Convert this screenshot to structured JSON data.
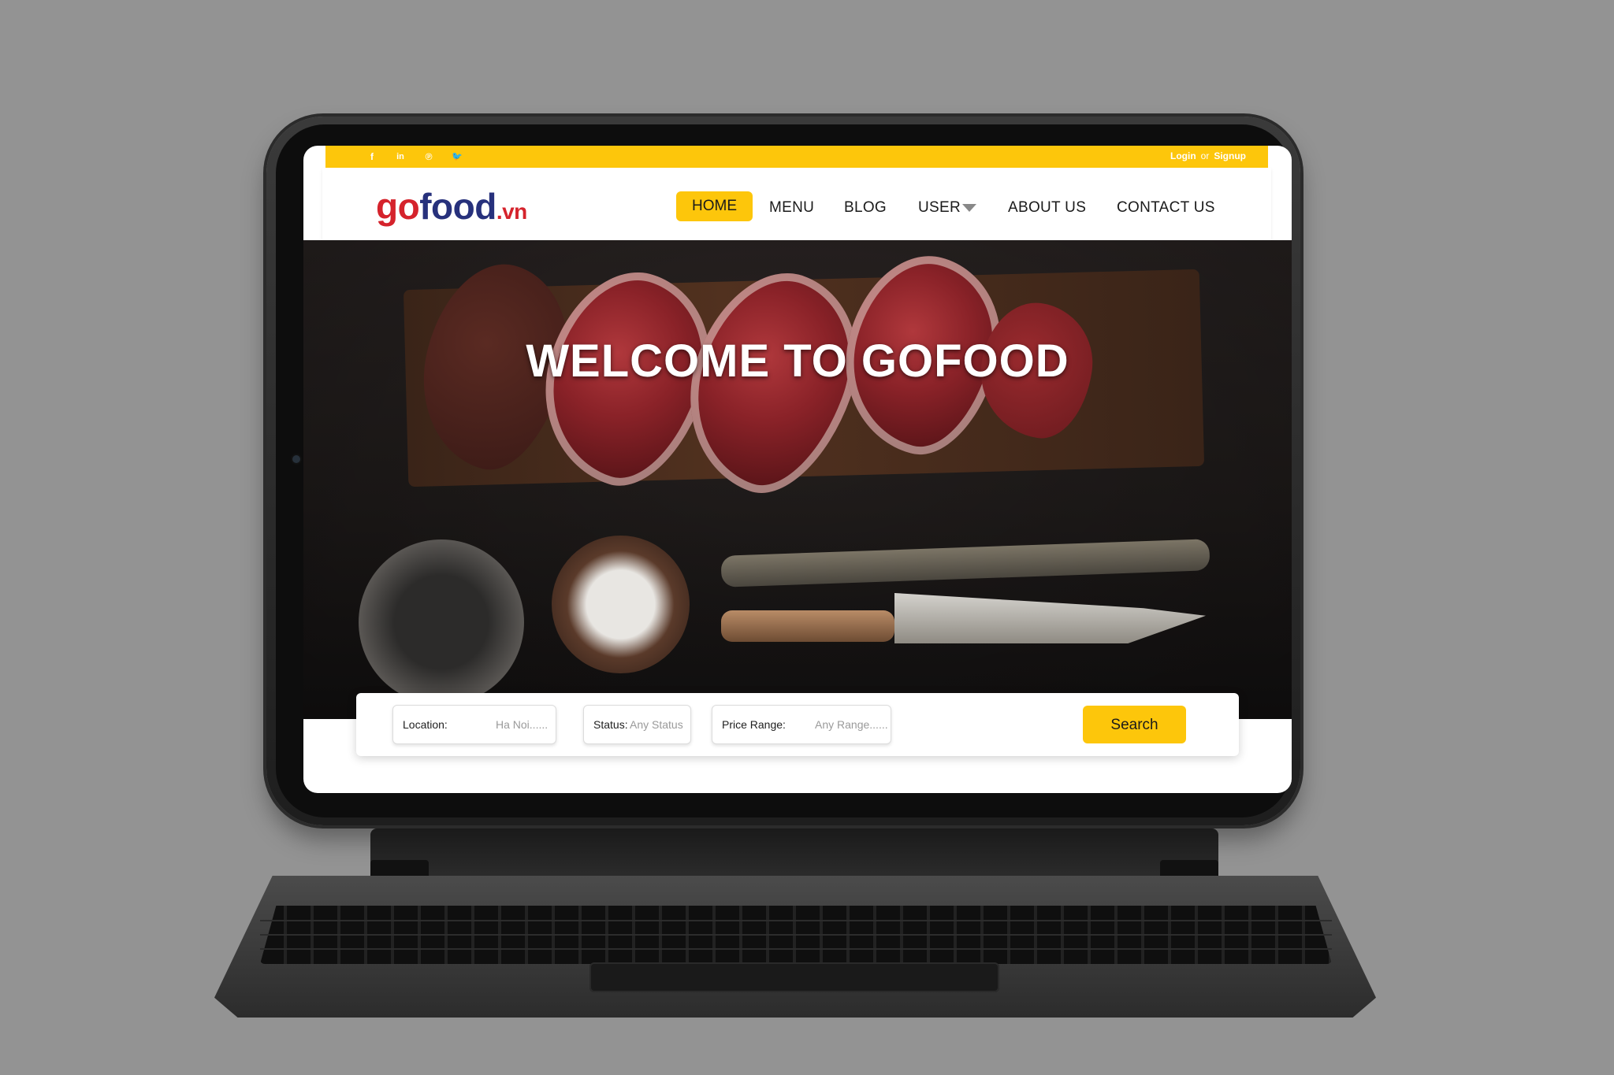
{
  "topbar": {
    "social": [
      {
        "icon": "facebook-icon",
        "glyph": "f"
      },
      {
        "icon": "linkedin-icon",
        "glyph": "in"
      },
      {
        "icon": "pinterest-icon",
        "glyph": "℗"
      },
      {
        "icon": "twitter-icon",
        "glyph": "🐦"
      }
    ],
    "login_label": "Login",
    "or_label": "or",
    "signup_label": "Signup"
  },
  "logo": {
    "go": "go",
    "food": "food",
    "vn": ".vn"
  },
  "nav": {
    "home": "HOME",
    "menu": "MENU",
    "blog": "BLOG",
    "user": "USER",
    "about": "ABOUT US",
    "contact": "CONTACT US"
  },
  "hero": {
    "title": "WELCOME TO GOFOOD"
  },
  "search": {
    "location_label": "Location:",
    "location_value": "Ha Noi......",
    "status_label": "Status:",
    "status_value": "Any Status",
    "price_label": "Price Range:",
    "price_value": "Any Range......",
    "button_label": "Search"
  },
  "colors": {
    "accent": "#fdc60b",
    "brand_red": "#d5232c",
    "brand_navy": "#27317c"
  }
}
